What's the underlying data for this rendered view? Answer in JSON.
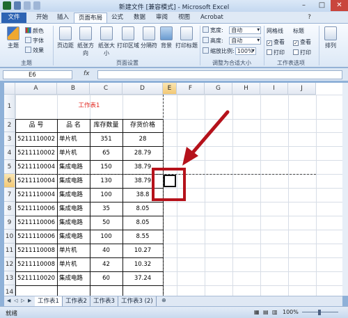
{
  "window": {
    "title": "新建文件  [兼容模式] - Microsoft Excel"
  },
  "tabs": [
    {
      "label": "文件"
    },
    {
      "label": "开始"
    },
    {
      "label": "插入"
    },
    {
      "label": "页面布局"
    },
    {
      "label": "公式"
    },
    {
      "label": "数据"
    },
    {
      "label": "审阅"
    },
    {
      "label": "视图"
    },
    {
      "label": "Acrobat"
    }
  ],
  "ribbon": {
    "theme": {
      "main": "主题",
      "colors": "颜色",
      "fonts": "字体",
      "effects": "效果",
      "group": "主题"
    },
    "page_setup": {
      "margins": "页边距",
      "orientation": "纸张方向",
      "size": "纸张大小",
      "print_area": "打印区域",
      "breaks": "分隔符",
      "background": "背景",
      "print_titles": "打印标题",
      "group": "页面设置"
    },
    "scale": {
      "width_label": "宽度:",
      "width_value": "自动",
      "height_label": "高度:",
      "height_value": "自动",
      "scale_label": "缩放比例:",
      "scale_value": "100%",
      "group": "调整为合适大小"
    },
    "options": {
      "gridlines": "网格线",
      "headings": "标题",
      "view": "查看",
      "print": "打印",
      "group": "工作表选项"
    },
    "arrange": {
      "label": "排列"
    }
  },
  "formula_bar": {
    "name_box": "E6",
    "fx": "fx",
    "formula": ""
  },
  "columns": [
    "A",
    "B",
    "C",
    "D",
    "E",
    "F",
    "G",
    "H",
    "I",
    "J"
  ],
  "rows": [
    "1",
    "2",
    "3",
    "4",
    "5",
    "6",
    "7",
    "8",
    "9",
    "10",
    "11",
    "12",
    "13",
    "14"
  ],
  "table": {
    "title": "工作表1",
    "headers": [
      "品  号",
      "品  名",
      "库存数量",
      "存货价格"
    ],
    "rows": [
      [
        "5211110002",
        "单片机",
        "351",
        "28"
      ],
      [
        "5211110002",
        "单片机",
        "65",
        "28.79"
      ],
      [
        "5211110004",
        "集成电路",
        "150",
        "38.79"
      ],
      [
        "5211110004",
        "集成电路",
        "130",
        "38.79"
      ],
      [
        "5211110004",
        "集成电路",
        "100",
        "38.8"
      ],
      [
        "5211110006",
        "集成电路",
        "35",
        "8.05"
      ],
      [
        "5211110006",
        "集成电路",
        "50",
        "8.05"
      ],
      [
        "5211110006",
        "集成电路",
        "100",
        "8.55"
      ],
      [
        "5211110008",
        "单片机",
        "40",
        "10.27"
      ],
      [
        "5211110008",
        "单片机",
        "42",
        "10.32"
      ],
      [
        "5211110020",
        "集成电路",
        "60",
        "37.24"
      ]
    ]
  },
  "sheet_tabs": [
    "工作表1",
    "工作表2",
    "工作表3",
    "工作表3 (2)"
  ],
  "status": {
    "ready": "就绪",
    "zoom": "100%"
  },
  "colors": {
    "title_red": "#e0241c",
    "annotation_red": "#b5121b",
    "selection": "#f2c874"
  }
}
